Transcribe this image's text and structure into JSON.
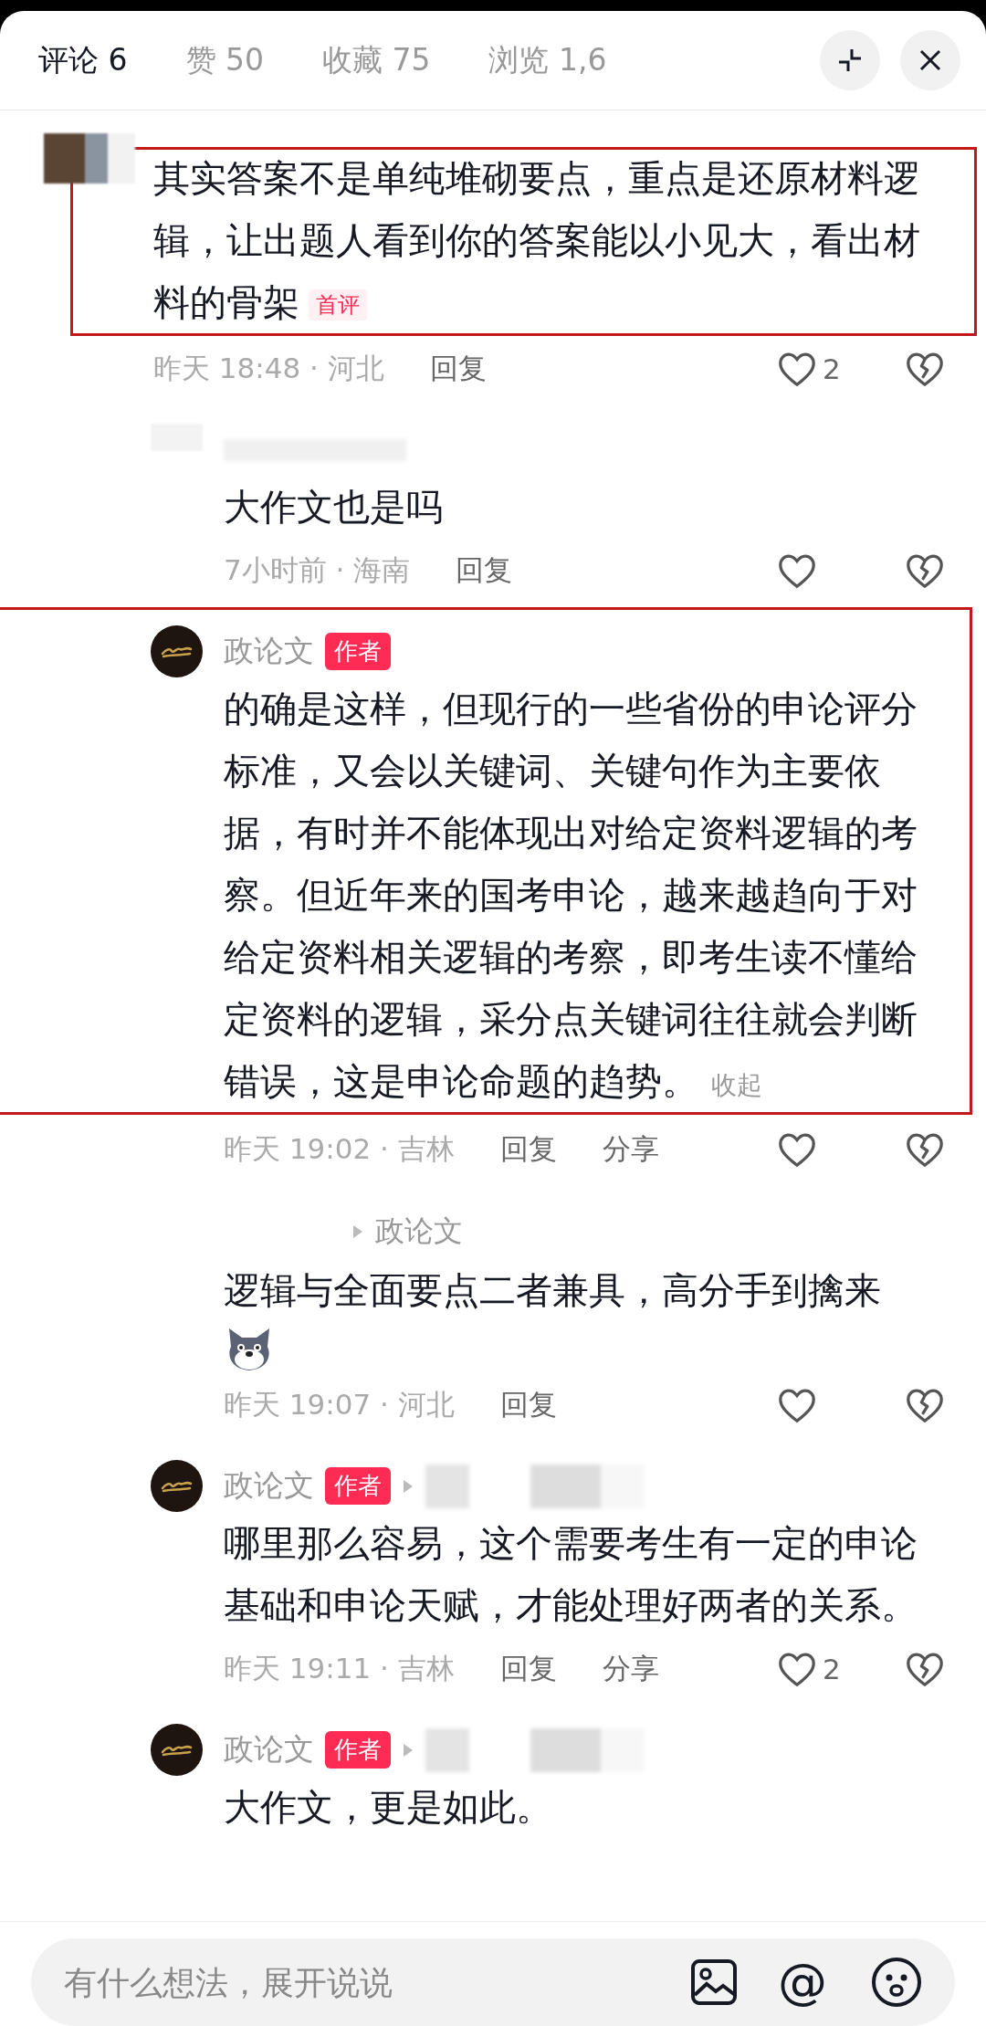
{
  "tabs": [
    {
      "label": "评论 6",
      "selected": true
    },
    {
      "label": "赞 50",
      "selected": false
    },
    {
      "label": "收藏 75",
      "selected": false
    },
    {
      "label": "浏览 1,6",
      "selected": false
    }
  ],
  "comments": [
    {
      "kind": "comment",
      "author_blurred": true,
      "highlighted": true,
      "text": "其实答案不是单纯堆砌要点，重点是还原材料逻辑，让出题人看到你的答案能以小见大，看出材料的骨架",
      "tag": "首评",
      "time_location": "昨天 18:48 · 河北",
      "reply_label": "回复",
      "likes": "2",
      "liked": false
    },
    {
      "kind": "reply",
      "author_blurred": true,
      "highlighted": false,
      "text": "大作文也是吗",
      "time_location": "7小时前 · 海南",
      "reply_label": "回复",
      "liked": false
    },
    {
      "kind": "reply",
      "author": "政论文",
      "badge": "作者",
      "highlighted": true,
      "text": "的确是这样，但现行的一些省份的申论评分标准，又会以关键词、关键句作为主要依据，有时并不能体现出对给定资料逻辑的考察。但近年来的国考申论，越来越趋向于对给定资料相关逻辑的考察，即考生读不懂给定资料的逻辑，采分点关键词往往就会判断错误，这是申论命题的趋势。",
      "collapse": "收起",
      "time_location": "昨天 19:02 · 吉林",
      "reply_label": "回复",
      "share_label": "分享",
      "liked": false
    },
    {
      "kind": "reply",
      "reply_to": "政论文",
      "highlighted": false,
      "text": "逻辑与全面要点二者兼具，高分手到擒来",
      "emoji": true,
      "time_location": "昨天 19:07 · 河北",
      "reply_label": "回复",
      "liked": false
    },
    {
      "kind": "reply",
      "author": "政论文",
      "badge": "作者",
      "reply_to_blurred": true,
      "highlighted": false,
      "text": "哪里那么容易，这个需要考生有一定的申论基础和申论天赋，才能处理好两者的关系。",
      "time_location": "昨天 19:11 · 吉林",
      "reply_label": "回复",
      "share_label": "分享",
      "likes": "2",
      "liked": false
    },
    {
      "kind": "reply",
      "author": "政论文",
      "badge": "作者",
      "reply_to_blurred": true,
      "highlighted": false,
      "text": "大作文，更是如此。"
    }
  ],
  "composer": {
    "placeholder": "有什么想法，展开说说",
    "mention": "@"
  }
}
